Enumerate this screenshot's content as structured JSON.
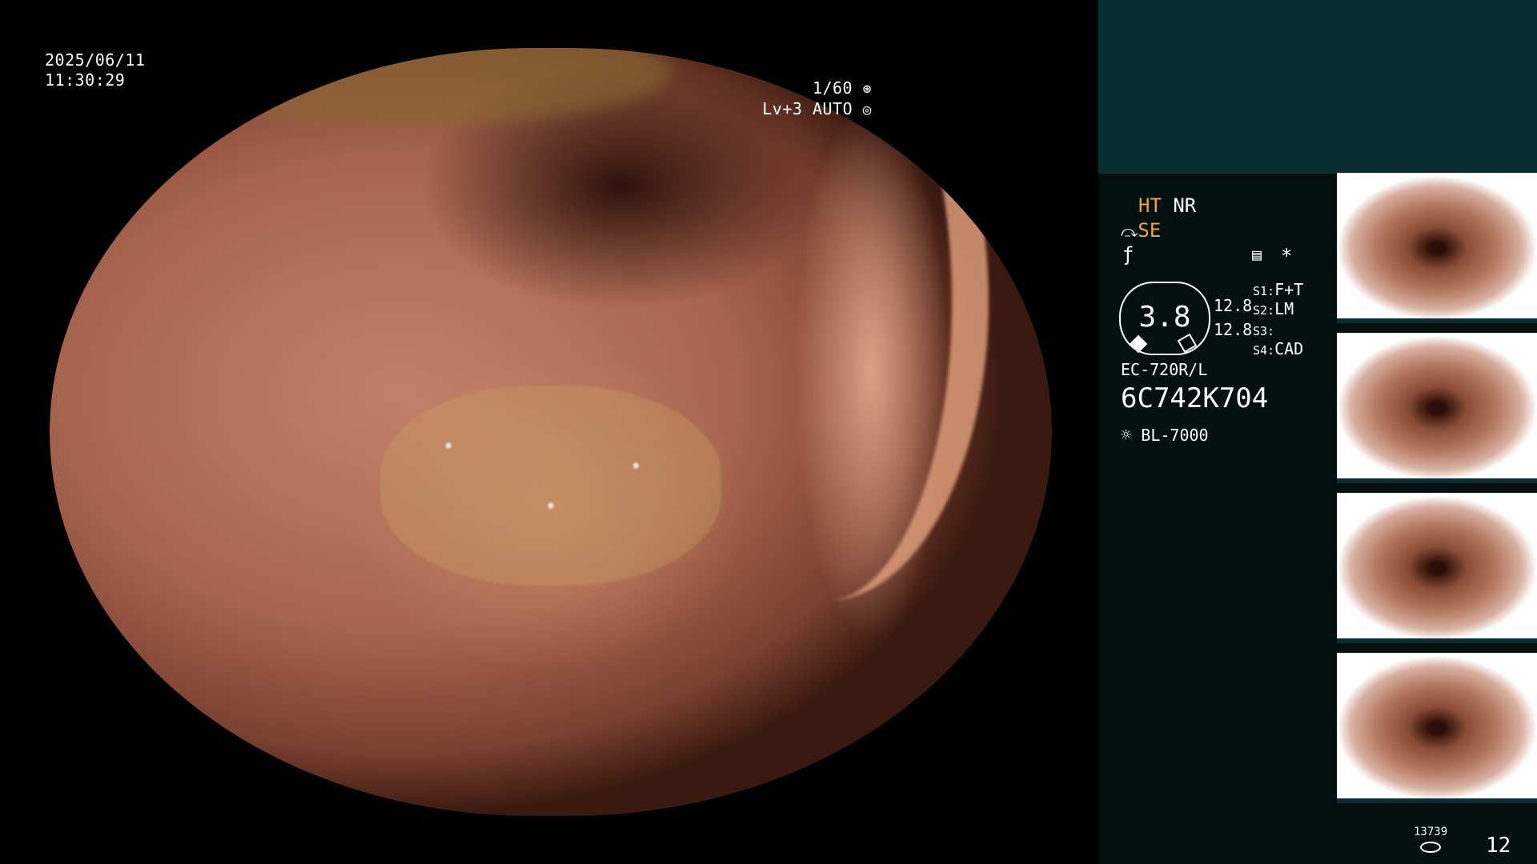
{
  "datetime": {
    "date": "2025/06/11",
    "time": "11:30:29"
  },
  "shutter": {
    "value": "1/60",
    "icon": "shutter-icon"
  },
  "level": {
    "value": "Lv+3 AUTO",
    "icon": "iris-icon"
  },
  "panel": {
    "ht": "HT",
    "nr": "NR",
    "se": "SE",
    "se_icon": "structure-enhance-icon",
    "f_icon": "f-symbol-icon",
    "memo_icon": "memo-icon",
    "asterisk": "*",
    "scale_value": "3.8",
    "readout_top": "12.8",
    "readout_bottom": "12.8",
    "s1_label": "S1:",
    "s1_value": "F+T",
    "s2_label": "S2:",
    "s2_value": "LM",
    "s3_label": "S3:",
    "s3_value": "",
    "s4_label": "S4:",
    "s4_value": "CAD",
    "scope_model": "EC-720R/L",
    "scope_serial": "6C742K704",
    "light_icon": "light-source-icon",
    "light_source": "BL-7000",
    "storage_count": "13739",
    "storage_icon": "storage-icon",
    "image_count": "12"
  },
  "thumbnails": [
    {
      "id": "thumb-1"
    },
    {
      "id": "thumb-2"
    },
    {
      "id": "thumb-3"
    },
    {
      "id": "thumb-4"
    }
  ],
  "colors": {
    "accent_orange": "#f0a830",
    "panel_bg": "#04100f",
    "teal_band": "#0a2e31"
  }
}
